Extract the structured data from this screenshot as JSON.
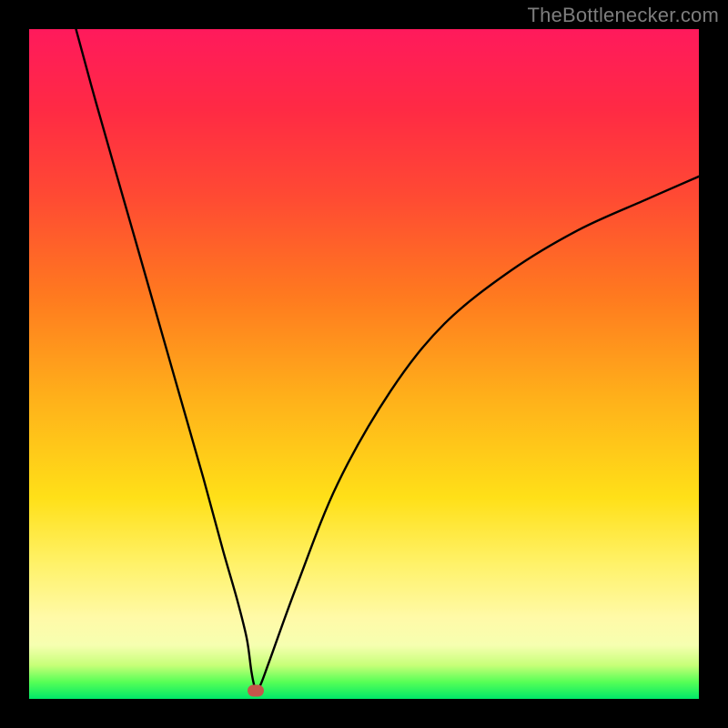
{
  "attribution": "TheBottlenecker.com",
  "chart_data": {
    "type": "line",
    "title": "",
    "xlabel": "",
    "ylabel": "",
    "xlim": [
      0,
      100
    ],
    "ylim": [
      0,
      100
    ],
    "series": [
      {
        "name": "bottleneck-curve",
        "x": [
          7,
          10,
          14,
          18,
          22,
          26,
          29,
          31,
          32.5,
          33.2,
          33.8,
          34.5,
          36,
          40,
          46,
          54,
          62,
          72,
          82,
          92,
          100
        ],
        "y": [
          100,
          89,
          75,
          61,
          47,
          33,
          22,
          15,
          9,
          4,
          1.5,
          2,
          6,
          17,
          32,
          46,
          56,
          64,
          70,
          74.5,
          78
        ]
      }
    ],
    "marker": {
      "x_pct": 33.8,
      "y_pct": 98.8
    },
    "gradient_stops": [
      {
        "pct": 0,
        "color": "#ff1a5c"
      },
      {
        "pct": 25,
        "color": "#ff4a33"
      },
      {
        "pct": 55,
        "color": "#ffb01a"
      },
      {
        "pct": 80,
        "color": "#fff26a"
      },
      {
        "pct": 95,
        "color": "#c6ff78"
      },
      {
        "pct": 100,
        "color": "#00e868"
      }
    ]
  }
}
